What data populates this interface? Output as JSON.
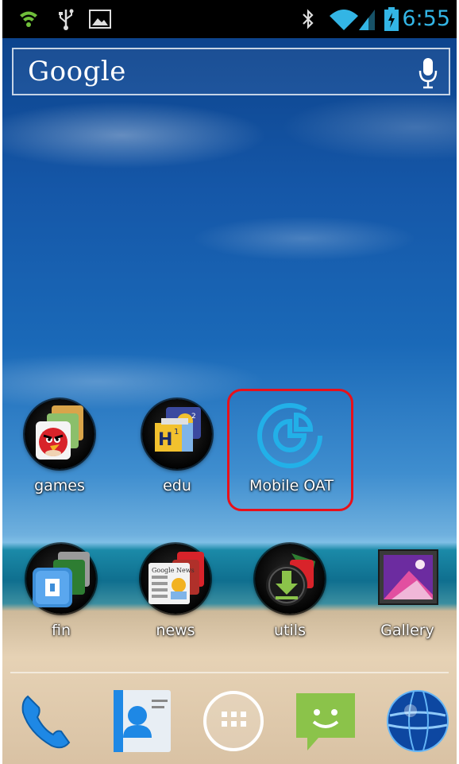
{
  "status_bar": {
    "time": "6:55",
    "icons": [
      "wifi-shield-icon",
      "usb-icon",
      "image-icon",
      "bluetooth-icon",
      "wifi-icon",
      "signal-icon",
      "battery-charging-icon"
    ]
  },
  "search": {
    "logo": "Google",
    "mic_icon": "microphone-icon"
  },
  "apps_row1": [
    {
      "label": "games",
      "icon": "games-folder-icon"
    },
    {
      "label": "edu",
      "icon": "edu-folder-icon"
    },
    {
      "label": "Mobile OAT",
      "icon": "mobile-oat-icon",
      "highlighted": true,
      "highlight_color": "#e8101a"
    }
  ],
  "apps_row2": [
    {
      "label": "fin",
      "icon": "fin-folder-icon"
    },
    {
      "label": "news",
      "icon": "news-folder-icon"
    },
    {
      "label": "utils",
      "icon": "utils-folder-icon"
    },
    {
      "label": "Gallery",
      "icon": "gallery-icon"
    }
  ],
  "dock": [
    "phone-icon",
    "contacts-icon",
    "app-drawer-icon",
    "messaging-icon",
    "browser-icon"
  ],
  "colors": {
    "accent": "#33b5e5",
    "highlight": "#e8101a"
  }
}
